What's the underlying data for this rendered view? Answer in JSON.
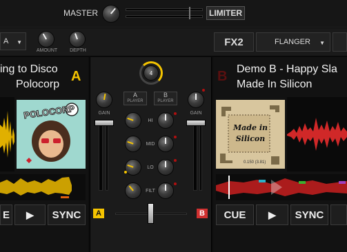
{
  "top": {
    "master_label": "MASTER",
    "limiter_label": "LIMITER"
  },
  "fx_left": {
    "mode_value": "A",
    "amount_label": "AMOUNT",
    "depth_label": "DEPTH"
  },
  "fx_right": {
    "unit_label": "FX2",
    "effect_value": "FLANGER"
  },
  "deck_a": {
    "title": "ing to Disco",
    "artist": "Polocorp",
    "letter": "A",
    "art_text": "POLOCORP",
    "buttons": {
      "cue": "E",
      "play": "▶",
      "sync": "SYNC"
    }
  },
  "deck_b": {
    "title": "Demo B - Happy Sla",
    "artist": "Made In Silicon",
    "letter": "B",
    "art_text_1": "Made in",
    "art_text_2": "Silicon",
    "art_caption": "0.150 (3.81)",
    "buttons": {
      "cue": "CUE",
      "play": "▶",
      "sync": "SYNC"
    }
  },
  "mixer": {
    "center_value": "4",
    "player_a_letter": "A",
    "player_b_letter": "B",
    "player_label": "PLAYER",
    "gain_label": "GAIN",
    "eq_labels": [
      "HI",
      "MID",
      "LO",
      "FILT"
    ],
    "crossfader_a": "A",
    "crossfader_b": "B"
  },
  "colors": {
    "accent_a": "#f5c400",
    "accent_b": "#d03030",
    "wave_a": "#e0b000",
    "wave_b": "#d02828"
  }
}
